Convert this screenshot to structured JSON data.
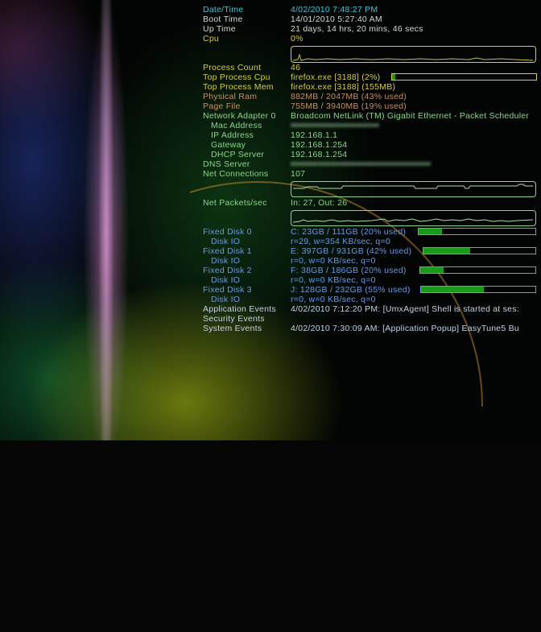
{
  "system": {
    "date_time": {
      "label": "Date/Time",
      "value": "4/02/2010 7:48:27 PM"
    },
    "boot_time": {
      "label": "Boot Time",
      "value": "14/01/2010 5:27:40 AM"
    },
    "up_time": {
      "label": "Up Time",
      "value": "21 days, 14 hrs, 20 mins, 46 secs"
    },
    "cpu": {
      "label": "Cpu",
      "value": "0%"
    },
    "process_count": {
      "label": "Process Count",
      "value": "46"
    },
    "top_cpu": {
      "label": "Top Process Cpu",
      "value": "firefox.exe [3188] (2%)",
      "percent": 2
    },
    "top_mem": {
      "label": "Top Process Mem",
      "value": "firefox.exe [3188] (155MB)"
    },
    "physical_ram": {
      "label": "Physical Ram",
      "value": "882MB / 2047MB (43% used)"
    },
    "page_file": {
      "label": "Page File",
      "value": "755MB / 3940MB (19% used)"
    }
  },
  "network": {
    "adapter": {
      "label": "Network Adapter 0",
      "value": "Broadcom NetLink (TM) Gigabit Ethernet - Packet Scheduler"
    },
    "mac": {
      "label": "Mac Address"
    },
    "ip": {
      "label": "IP Address",
      "value": "192.168.1.1"
    },
    "gateway": {
      "label": "Gateway",
      "value": "192.168.1.254"
    },
    "dhcp": {
      "label": "DHCP Server",
      "value": "192.168.1.254"
    },
    "dns": {
      "label": "DNS Server"
    },
    "connections": {
      "label": "Net Connections",
      "value": "107"
    },
    "packets": {
      "label": "Net Packets/sec",
      "value": "In: 27, Out: 26"
    }
  },
  "disks": [
    {
      "label": "Fixed Disk 0",
      "value": "C: 23GB / 111GB (20% used)",
      "percent": 20,
      "io_label": "Disk IO",
      "io": "r=29, w=354 KB/sec, q=0"
    },
    {
      "label": "Fixed Disk 1",
      "value": "E: 397GB / 931GB (42% used)",
      "percent": 42,
      "io_label": "Disk IO",
      "io": "r=0, w=0 KB/sec, q=0"
    },
    {
      "label": "Fixed Disk 2",
      "value": "F: 38GB / 186GB (20% used)",
      "percent": 20,
      "io_label": "Disk IO",
      "io": "r=0, w=0 KB/sec, q=0"
    },
    {
      "label": "Fixed Disk 3",
      "value": "J: 128GB / 232GB (55% used)",
      "percent": 55,
      "io_label": "Disk IO",
      "io": "r=0, w=0 KB/sec, q=0"
    }
  ],
  "events": {
    "application": {
      "label": "Application Events",
      "value": "4/02/2010 7:12:20 PM: [UmxAgent] Shell is started at ses:"
    },
    "security": {
      "label": "Security Events"
    },
    "system": {
      "label": "System Events",
      "value": "4/02/2010 7:30:09 AM: [Application Popup] EasyTune5 Bu"
    }
  },
  "colors": {
    "cpu": "#d8cc3c",
    "network": "#8cd48c",
    "disk": "#6a9ae0",
    "bar_fill": "#1a9a1a"
  }
}
